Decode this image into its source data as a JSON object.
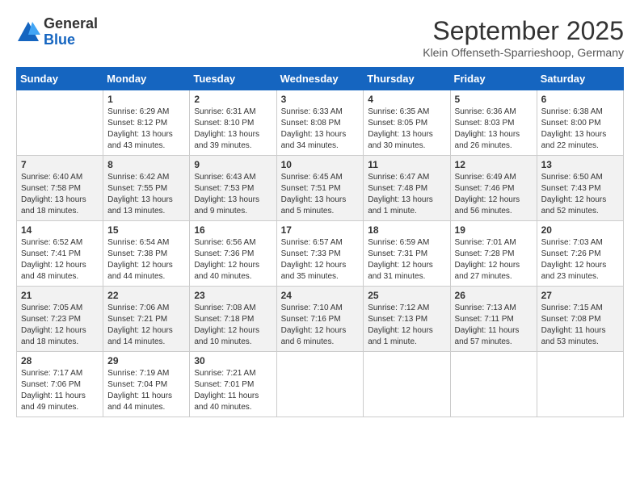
{
  "logo": {
    "general": "General",
    "blue": "Blue"
  },
  "title": "September 2025",
  "location": "Klein Offenseth-Sparrieshoop, Germany",
  "days_of_week": [
    "Sunday",
    "Monday",
    "Tuesday",
    "Wednesday",
    "Thursday",
    "Friday",
    "Saturday"
  ],
  "weeks": [
    [
      {
        "day": "",
        "info": ""
      },
      {
        "day": "1",
        "info": "Sunrise: 6:29 AM\nSunset: 8:12 PM\nDaylight: 13 hours\nand 43 minutes."
      },
      {
        "day": "2",
        "info": "Sunrise: 6:31 AM\nSunset: 8:10 PM\nDaylight: 13 hours\nand 39 minutes."
      },
      {
        "day": "3",
        "info": "Sunrise: 6:33 AM\nSunset: 8:08 PM\nDaylight: 13 hours\nand 34 minutes."
      },
      {
        "day": "4",
        "info": "Sunrise: 6:35 AM\nSunset: 8:05 PM\nDaylight: 13 hours\nand 30 minutes."
      },
      {
        "day": "5",
        "info": "Sunrise: 6:36 AM\nSunset: 8:03 PM\nDaylight: 13 hours\nand 26 minutes."
      },
      {
        "day": "6",
        "info": "Sunrise: 6:38 AM\nSunset: 8:00 PM\nDaylight: 13 hours\nand 22 minutes."
      }
    ],
    [
      {
        "day": "7",
        "info": "Sunrise: 6:40 AM\nSunset: 7:58 PM\nDaylight: 13 hours\nand 18 minutes."
      },
      {
        "day": "8",
        "info": "Sunrise: 6:42 AM\nSunset: 7:55 PM\nDaylight: 13 hours\nand 13 minutes."
      },
      {
        "day": "9",
        "info": "Sunrise: 6:43 AM\nSunset: 7:53 PM\nDaylight: 13 hours\nand 9 minutes."
      },
      {
        "day": "10",
        "info": "Sunrise: 6:45 AM\nSunset: 7:51 PM\nDaylight: 13 hours\nand 5 minutes."
      },
      {
        "day": "11",
        "info": "Sunrise: 6:47 AM\nSunset: 7:48 PM\nDaylight: 13 hours\nand 1 minute."
      },
      {
        "day": "12",
        "info": "Sunrise: 6:49 AM\nSunset: 7:46 PM\nDaylight: 12 hours\nand 56 minutes."
      },
      {
        "day": "13",
        "info": "Sunrise: 6:50 AM\nSunset: 7:43 PM\nDaylight: 12 hours\nand 52 minutes."
      }
    ],
    [
      {
        "day": "14",
        "info": "Sunrise: 6:52 AM\nSunset: 7:41 PM\nDaylight: 12 hours\nand 48 minutes."
      },
      {
        "day": "15",
        "info": "Sunrise: 6:54 AM\nSunset: 7:38 PM\nDaylight: 12 hours\nand 44 minutes."
      },
      {
        "day": "16",
        "info": "Sunrise: 6:56 AM\nSunset: 7:36 PM\nDaylight: 12 hours\nand 40 minutes."
      },
      {
        "day": "17",
        "info": "Sunrise: 6:57 AM\nSunset: 7:33 PM\nDaylight: 12 hours\nand 35 minutes."
      },
      {
        "day": "18",
        "info": "Sunrise: 6:59 AM\nSunset: 7:31 PM\nDaylight: 12 hours\nand 31 minutes."
      },
      {
        "day": "19",
        "info": "Sunrise: 7:01 AM\nSunset: 7:28 PM\nDaylight: 12 hours\nand 27 minutes."
      },
      {
        "day": "20",
        "info": "Sunrise: 7:03 AM\nSunset: 7:26 PM\nDaylight: 12 hours\nand 23 minutes."
      }
    ],
    [
      {
        "day": "21",
        "info": "Sunrise: 7:05 AM\nSunset: 7:23 PM\nDaylight: 12 hours\nand 18 minutes."
      },
      {
        "day": "22",
        "info": "Sunrise: 7:06 AM\nSunset: 7:21 PM\nDaylight: 12 hours\nand 14 minutes."
      },
      {
        "day": "23",
        "info": "Sunrise: 7:08 AM\nSunset: 7:18 PM\nDaylight: 12 hours\nand 10 minutes."
      },
      {
        "day": "24",
        "info": "Sunrise: 7:10 AM\nSunset: 7:16 PM\nDaylight: 12 hours\nand 6 minutes."
      },
      {
        "day": "25",
        "info": "Sunrise: 7:12 AM\nSunset: 7:13 PM\nDaylight: 12 hours\nand 1 minute."
      },
      {
        "day": "26",
        "info": "Sunrise: 7:13 AM\nSunset: 7:11 PM\nDaylight: 11 hours\nand 57 minutes."
      },
      {
        "day": "27",
        "info": "Sunrise: 7:15 AM\nSunset: 7:08 PM\nDaylight: 11 hours\nand 53 minutes."
      }
    ],
    [
      {
        "day": "28",
        "info": "Sunrise: 7:17 AM\nSunset: 7:06 PM\nDaylight: 11 hours\nand 49 minutes."
      },
      {
        "day": "29",
        "info": "Sunrise: 7:19 AM\nSunset: 7:04 PM\nDaylight: 11 hours\nand 44 minutes."
      },
      {
        "day": "30",
        "info": "Sunrise: 7:21 AM\nSunset: 7:01 PM\nDaylight: 11 hours\nand 40 minutes."
      },
      {
        "day": "",
        "info": ""
      },
      {
        "day": "",
        "info": ""
      },
      {
        "day": "",
        "info": ""
      },
      {
        "day": "",
        "info": ""
      }
    ]
  ],
  "row_styles": [
    "white",
    "shaded",
    "white",
    "shaded",
    "white"
  ]
}
